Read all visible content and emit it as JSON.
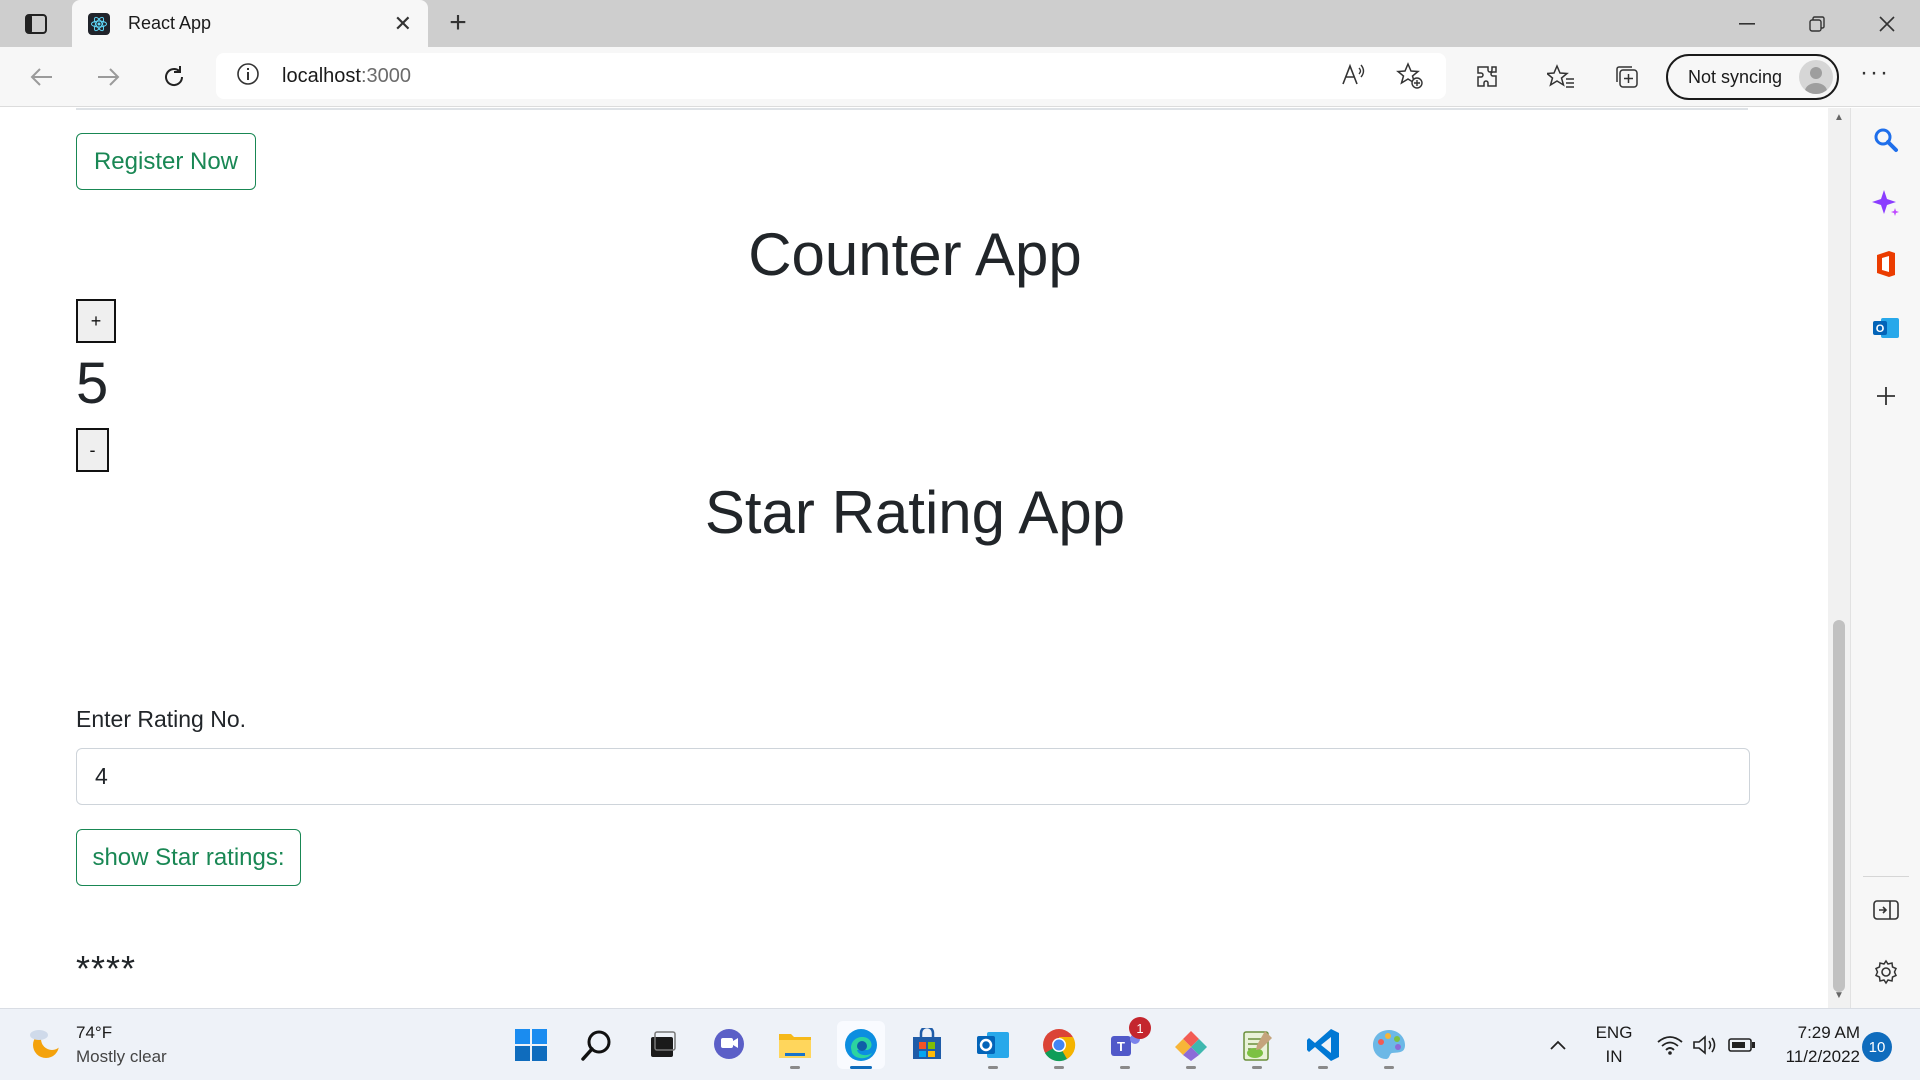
{
  "browser": {
    "tab_title": "React App",
    "close_glyph": "✕",
    "new_tab_glyph": "+",
    "address_host": "localhost",
    "address_port": ":3000",
    "sync_label": "Not syncing",
    "more_glyph": "···"
  },
  "page": {
    "register_button": "Register Now",
    "counter_title": "Counter App",
    "increment_label": "+",
    "counter_value": "5",
    "decrement_label": "-",
    "star_title": "Star Rating App",
    "rating_label": "Enter Rating No.",
    "rating_value": "4",
    "show_button": "show Star ratings:",
    "stars_output": "****"
  },
  "taskbar": {
    "temperature": "74°F",
    "weather_desc": "Mostly clear",
    "language_line1": "ENG",
    "language_line2": "IN",
    "time": "7:29 AM",
    "date": "11/2/2022",
    "notification_count": "10",
    "teams_badge": "1"
  },
  "colors": {
    "accent_green": "#198754",
    "edge_blue": "#0f6cbd"
  }
}
